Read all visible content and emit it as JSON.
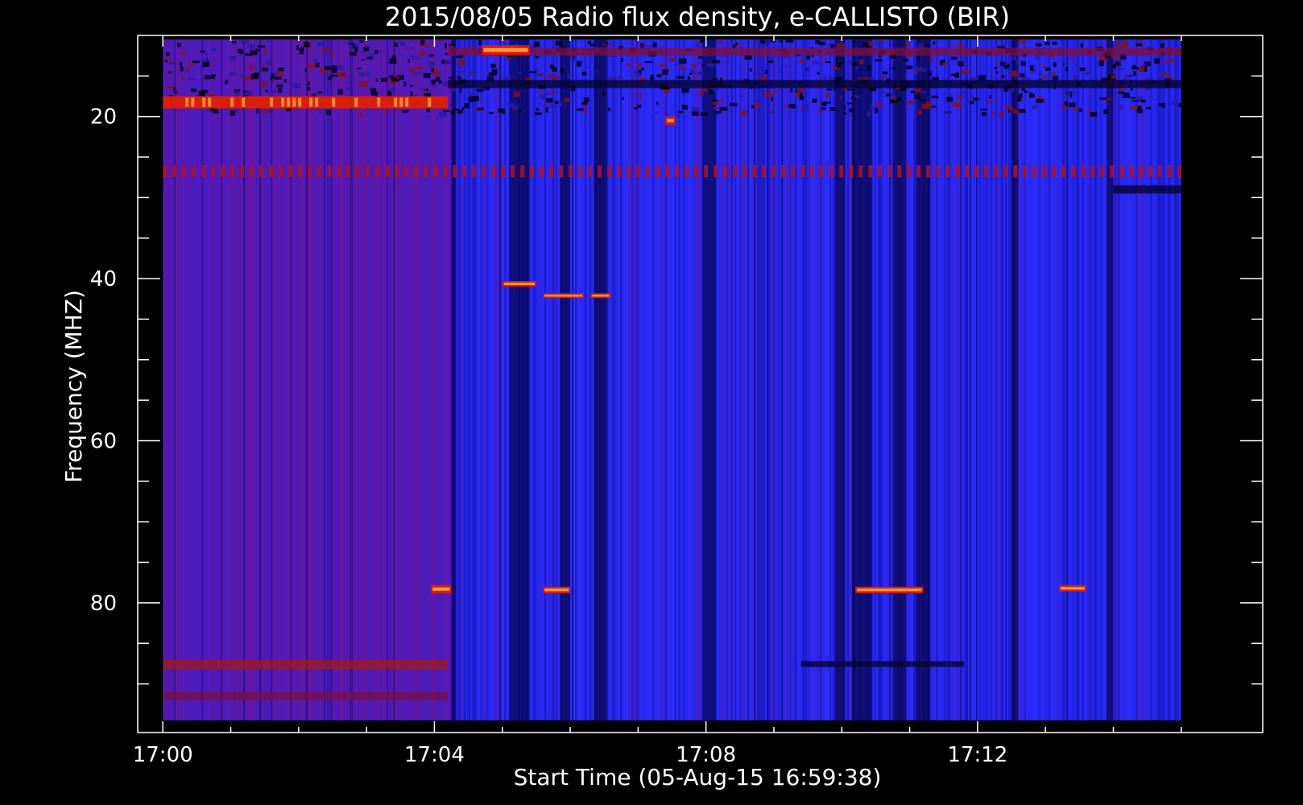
{
  "chart_data": {
    "type": "heatmap",
    "title": "2015/08/05  Radio flux density, e-CALLISTO (BIR)",
    "xlabel": "Start Time (05-Aug-15 16:59:38)",
    "ylabel": "Frequency (MHZ)",
    "x_unit": "minutes after 17:00",
    "xlim": [
      -0.37,
      16.2
    ],
    "ylim_top_to_bottom": [
      10,
      96
    ],
    "data_extent": {
      "x": [
        0,
        15
      ],
      "y": [
        10.5,
        94.5
      ]
    },
    "x_ticks": [
      {
        "value": 0,
        "label": "17:00"
      },
      {
        "value": 4,
        "label": "17:04"
      },
      {
        "value": 8,
        "label": "17:08"
      },
      {
        "value": 12,
        "label": "17:12"
      }
    ],
    "x_minor_ticks": [
      1,
      2,
      3,
      5,
      6,
      7,
      9,
      10,
      11,
      13,
      14,
      15
    ],
    "y_ticks": [
      {
        "value": 20,
        "label": "20"
      },
      {
        "value": 40,
        "label": "40"
      },
      {
        "value": 60,
        "label": "60"
      },
      {
        "value": 80,
        "label": "80"
      }
    ],
    "y_minor_ticks": [
      15,
      25,
      30,
      35,
      45,
      50,
      55,
      65,
      70,
      75,
      85,
      90
    ],
    "colormap": [
      "#000000",
      "#1010e0",
      "#3a14ff",
      "#7a1490",
      "#cc1100",
      "#ff6600",
      "#ffee55"
    ],
    "background_regions": [
      {
        "t": [
          0,
          4.25
        ],
        "level": "purple-red",
        "color": "#4a1cb8"
      },
      {
        "t": [
          4.25,
          15
        ],
        "level": "blue",
        "color": "#2828f0"
      }
    ],
    "dark_columns": [
      {
        "t": [
          4.25,
          4.32
        ]
      },
      {
        "t": [
          5.1,
          5.4
        ]
      },
      {
        "t": [
          5.85,
          6.0
        ]
      },
      {
        "t": [
          6.35,
          6.55
        ]
      },
      {
        "t": [
          7.95,
          8.15
        ]
      },
      {
        "t": [
          9.9,
          10.05
        ]
      },
      {
        "t": [
          10.15,
          10.45
        ]
      },
      {
        "t": [
          10.75,
          10.95
        ]
      },
      {
        "t": [
          11.1,
          11.3
        ]
      },
      {
        "t": [
          12.5,
          12.6
        ]
      },
      {
        "t": [
          13.9,
          14.0
        ]
      }
    ],
    "red_bands": [
      {
        "t": [
          0,
          4.2
        ],
        "f": [
          17.5,
          19.0
        ],
        "intensity": "bright"
      },
      {
        "t": [
          0,
          15
        ],
        "f": [
          26.0,
          27.5
        ],
        "intensity": "dashed"
      },
      {
        "t": [
          0,
          4.2
        ],
        "f": [
          87.0,
          88.2
        ],
        "intensity": "medium"
      },
      {
        "t": [
          0,
          4.2
        ],
        "f": [
          91.0,
          92.0
        ],
        "intensity": "faint"
      },
      {
        "t": [
          4.2,
          15
        ],
        "f": [
          11.5,
          12.5
        ],
        "intensity": "faint"
      }
    ],
    "bursts": [
      {
        "t": [
          4.7,
          5.4
        ],
        "f": [
          11.2,
          12.4
        ]
      },
      {
        "t": [
          3.95,
          4.25
        ],
        "f": [
          77.8,
          78.8
        ]
      },
      {
        "t": [
          5.6,
          6.0
        ],
        "f": [
          78.0,
          78.8
        ]
      },
      {
        "t": [
          10.2,
          11.2
        ],
        "f": [
          78.0,
          78.8
        ]
      },
      {
        "t": [
          13.2,
          13.6
        ],
        "f": [
          77.8,
          78.6
        ]
      },
      {
        "t": [
          5.0,
          5.5
        ],
        "f": [
          40.3,
          41.0
        ]
      },
      {
        "t": [
          5.6,
          6.2
        ],
        "f": [
          41.8,
          42.4
        ]
      },
      {
        "t": [
          6.3,
          6.6
        ],
        "f": [
          41.8,
          42.4
        ]
      },
      {
        "t": [
          7.4,
          7.55
        ],
        "f": [
          20.0,
          21.0
        ]
      }
    ],
    "dark_rows": [
      {
        "t": [
          9.4,
          11.8
        ],
        "f": [
          87.2,
          87.9
        ]
      },
      {
        "t": [
          14.0,
          15
        ],
        "f": [
          28.5,
          29.5
        ]
      },
      {
        "t": [
          4.2,
          15
        ],
        "f": [
          15.5,
          16.5
        ]
      }
    ]
  }
}
